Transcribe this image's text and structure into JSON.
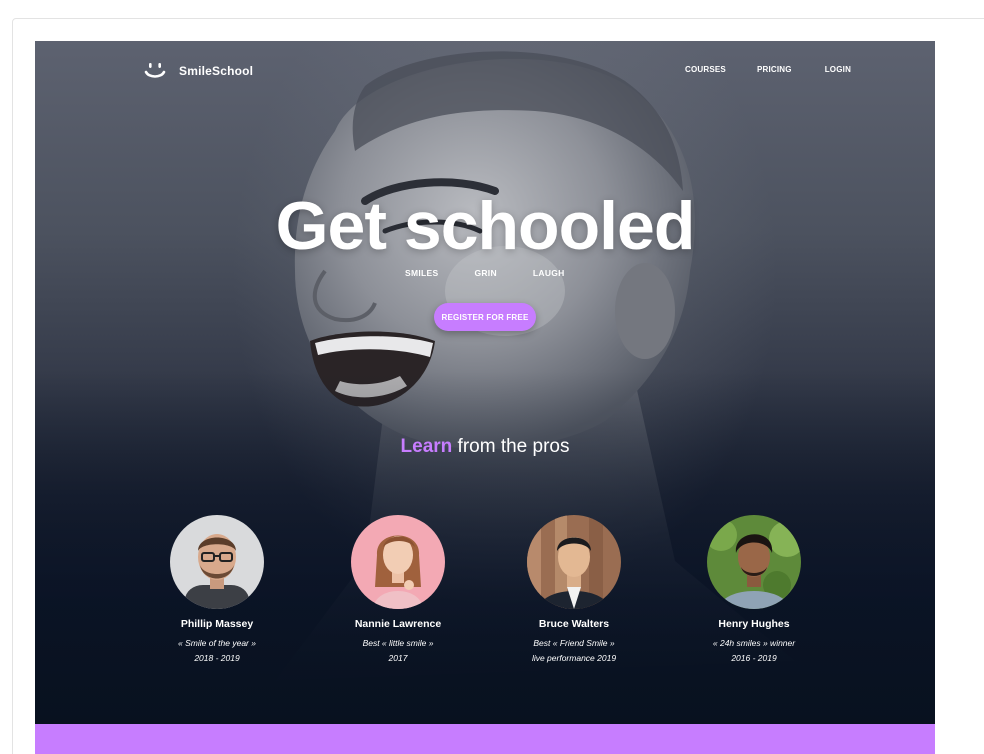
{
  "brand": {
    "name": "SmileSchool",
    "logo_icon": "smiley-icon"
  },
  "nav": {
    "items": [
      "COURSES",
      "PRICING",
      "LOGIN"
    ]
  },
  "hero": {
    "headline": "Get schooled",
    "tags": [
      "SMILES",
      "GRIN",
      "LAUGH"
    ],
    "cta_label": "REGISTER FOR FREE"
  },
  "pros": {
    "highlight": "Learn",
    "rest": "from the pros",
    "members": [
      {
        "name": "Phillip Massey",
        "line1": "« Smile of the year »",
        "line2": "2018 - 2019"
      },
      {
        "name": "Nannie Lawrence",
        "line1": "Best « little smile »",
        "line2": "2017"
      },
      {
        "name": "Bruce Walters",
        "line1": "Best « Friend Smile »",
        "line2": "live performance 2019"
      },
      {
        "name": "Henry Hughes",
        "line1": "« 24h smiles » winner",
        "line2": "2016 - 2019"
      }
    ]
  },
  "colors": {
    "accent": "#c77dff",
    "background_dark": "#08111f"
  }
}
